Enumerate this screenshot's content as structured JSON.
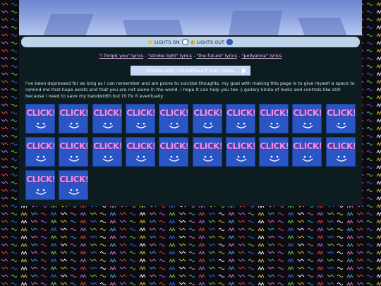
{
  "lights": {
    "on_label": "LIGHTS ON",
    "out_label": "LIGHTS OUT"
  },
  "lyrics_links": [
    {
      "label": "\"i forgot you\" lyrics"
    },
    {
      "label": "\"strobe light\" lyrics"
    },
    {
      "label": "\"the future\" lyrics"
    },
    {
      "label": "\"pollyanna\" lyrics"
    }
  ],
  "player": {
    "track": "Strobe Light - PowaPowa-P feat. Hatsu"
  },
  "intro_text": "i've been depressed for as long as i can remember and am prone to suicidal thoughts. my goal with making this page is to give myself a space to remind me that hope exists and that you are not alone in the world. i hope it can help you too :) gallery kinda of looks and controls like shit because i need to save my bandwidth but i'll fix it eventually",
  "gallery": {
    "tile_label": "CLICK!",
    "tile_count": 22
  },
  "colors": {
    "tile_bg": "#2a55c4",
    "click_text": "#f08de6",
    "panel_bg": "#0d1c1f",
    "lights_bar": "#bcd3ea"
  }
}
